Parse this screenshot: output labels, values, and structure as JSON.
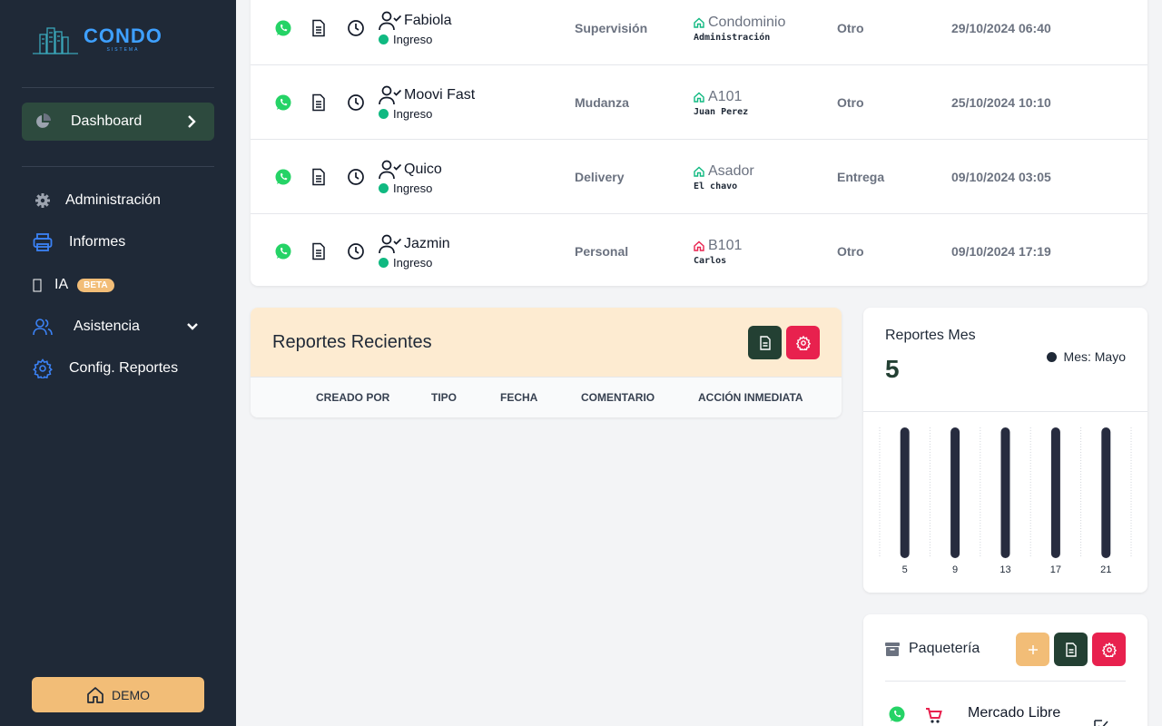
{
  "brand": {
    "name": "CONDO",
    "tagline": "SISTEMA"
  },
  "sidebar": {
    "dashboard": {
      "label": "Dashboard"
    },
    "items": [
      {
        "label": "Administración",
        "icon": "gear-icon"
      },
      {
        "label": "Informes",
        "icon": "printer-icon"
      },
      {
        "label": "IA",
        "icon": "robot-icon",
        "badge": "BETA"
      },
      {
        "label": "Asistencia",
        "icon": "users-icon"
      },
      {
        "label": "Config. Reportes",
        "icon": "settings-icon"
      }
    ],
    "demo_label": "DEMO"
  },
  "visits": [
    {
      "name": "Fabiola",
      "status": "Ingreso",
      "type": "Supervisión",
      "place": "Condominio",
      "place_sub": "Administración",
      "category": "Otro",
      "datetime": "29/10/2024 06:40",
      "home_color": "#10b981"
    },
    {
      "name": "Moovi Fast",
      "status": "Ingreso",
      "type": "Mudanza",
      "place": "A101",
      "place_sub": "Juan Perez",
      "category": "Otro",
      "datetime": "25/10/2024 10:10",
      "home_color": "#10b981"
    },
    {
      "name": "Quico",
      "status": "Ingreso",
      "type": "Delivery",
      "place": "Asador",
      "place_sub": "El chavo",
      "category": "Entrega",
      "datetime": "09/10/2024 03:05",
      "home_color": "#10b981"
    },
    {
      "name": "Jazmin",
      "status": "Ingreso",
      "type": "Personal",
      "place": "B101",
      "place_sub": "Carlos",
      "category": "Otro",
      "datetime": "09/10/2024 17:19",
      "home_color": "#e8214e"
    }
  ],
  "reportes_recientes": {
    "title": "Reportes Recientes",
    "columns": [
      "CREADO POR",
      "TIPO",
      "FECHA",
      "COMENTARIO",
      "ACCIÓN INMEDIATA"
    ]
  },
  "reportes_mes": {
    "title": "Reportes Mes",
    "value": "5",
    "legend": "Mes: Mayo"
  },
  "chart_data": {
    "type": "bar",
    "categories": [
      "5",
      "9",
      "13",
      "17",
      "21"
    ],
    "values": [
      1,
      1,
      1,
      1,
      1
    ],
    "ylim": [
      0,
      1
    ],
    "grid": true
  },
  "paqueteria": {
    "title": "Paquetería",
    "first_item": "Mercado Libre"
  },
  "colors": {
    "sidebar": "#1f2937",
    "accent_green": "#234033",
    "accent_red": "#e8214e",
    "accent_orange": "#f2bd77",
    "status_green": "#10b981"
  }
}
